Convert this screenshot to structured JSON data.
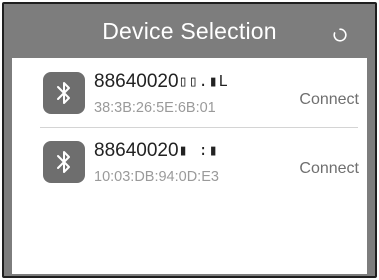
{
  "dialog": {
    "title": "Device Selection",
    "refresh_icon": "refresh-icon"
  },
  "devices": [
    {
      "name": "88640020",
      "name_masked": "▯▯.▮L",
      "mac": "38:3B:26:5E:6B:01",
      "action": "Connect",
      "icon": "bluetooth-icon"
    },
    {
      "name": "88640020",
      "name_masked": "▮ :▮",
      "mac": "10:03:DB:94:0D:E3",
      "action": "Connect",
      "icon": "bluetooth-icon"
    }
  ],
  "colors": {
    "header_bg": "#7d7d7d",
    "panel_bg": "#ffffff",
    "tile_bg": "#6e6e6e",
    "title_text": "#ffffff",
    "mac_text": "#9a9a9a",
    "connect_text": "#6f6f6f"
  }
}
